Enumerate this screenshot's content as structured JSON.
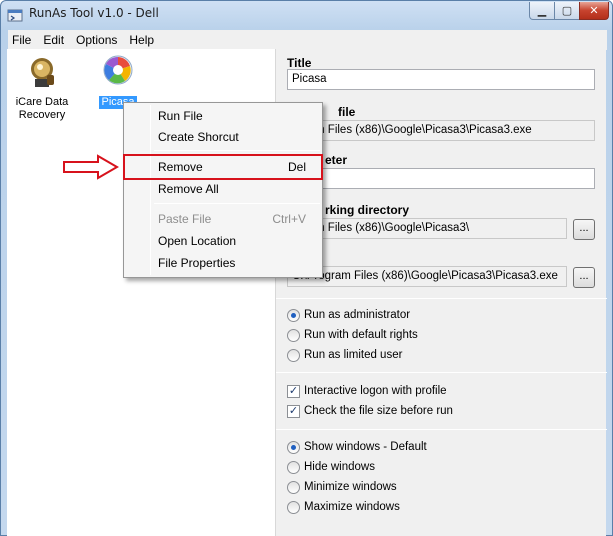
{
  "window": {
    "title": "RunAs Tool v1.0 - Dell"
  },
  "menu": [
    "File",
    "Edit",
    "Options",
    "Help"
  ],
  "apps": [
    {
      "label": "iCare Data Recovery"
    },
    {
      "label": "Picasa",
      "selected": true
    }
  ],
  "context_menu": {
    "items": [
      {
        "label": "Run File"
      },
      {
        "label": "Create Shorcut"
      },
      {
        "label": "Remove",
        "shortcut": "Del",
        "highlighted": true
      },
      {
        "label": "Remove All"
      },
      {
        "label": "Paste File",
        "shortcut": "Ctrl+V",
        "disabled": true
      },
      {
        "label": "Open Location"
      },
      {
        "label": "File Properties"
      }
    ]
  },
  "details": {
    "title_label": "Title",
    "title_value": "Picasa",
    "file_label": "file",
    "file_value": "ogram Files (x86)\\Google\\Picasa3\\Picasa3.exe",
    "param_label": "eter",
    "param_value": "",
    "workdir_label": "rking directory",
    "workdir_value": "ogram Files (x86)\\Google\\Picasa3\\",
    "icon_value": "C:\\Program Files (x86)\\Google\\Picasa3\\Picasa3.exe",
    "browse_label": "...",
    "rights_options": [
      "Run as administrator",
      "Run with default rights",
      "Run as limited user"
    ],
    "rights_selected": 0,
    "checks": [
      {
        "label": "Interactive logon with profile",
        "checked": true
      },
      {
        "label": "Check the file size before run",
        "checked": true
      }
    ],
    "window_options": [
      "Show windows - Default",
      "Hide windows",
      "Minimize windows",
      "Maximize windows"
    ],
    "window_selected": 0
  },
  "colors": {
    "highlight": "#d7121c",
    "selection": "#3399ff"
  }
}
